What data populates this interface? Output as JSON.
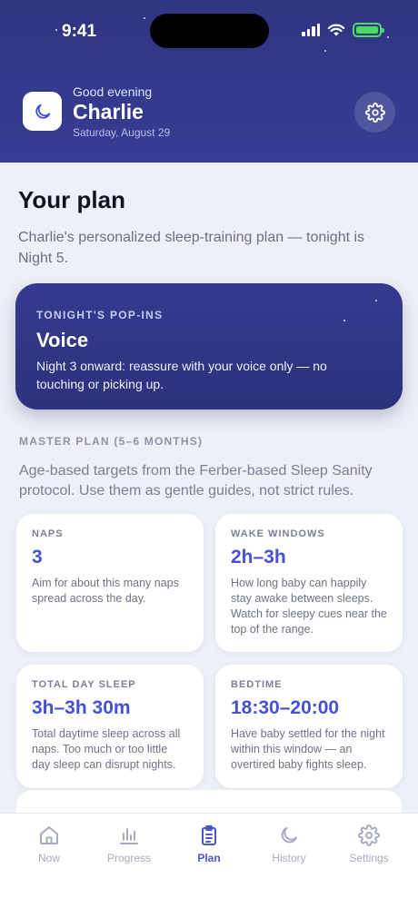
{
  "status_bar": {
    "time": "9:41"
  },
  "header": {
    "greeting": "Good evening",
    "name": "Charlie",
    "date": "Saturday, August 29"
  },
  "plan": {
    "title": "Your plan",
    "description": "Charlie's personalized sleep-training plan — tonight is Night 5."
  },
  "tonight": {
    "kicker": "TONIGHT'S POP-INS",
    "title": "Voice",
    "description": "Night 3 onward: reassure with your voice only — no touching or picking up."
  },
  "master_plan": {
    "label": "MASTER PLAN (5–6 MONTHS)",
    "description": "Age-based targets from the Ferber-based Sleep Sanity protocol. Use them as gentle guides, not strict rules.",
    "cards": [
      {
        "label": "NAPS",
        "value": "3",
        "description": "Aim for about this many naps spread across the day."
      },
      {
        "label": "WAKE WINDOWS",
        "value": "2h–3h",
        "description": "How long baby can happily stay awake between sleeps. Watch for sleepy cues near the top of the range."
      },
      {
        "label": "TOTAL DAY SLEEP",
        "value": "3h–3h 30m",
        "description": "Total daytime sleep across all naps. Too much or too little day sleep can disrupt nights."
      },
      {
        "label": "BEDTIME",
        "value": "18:30–20:00",
        "description": "Have baby settled for the night within this window — an overtired baby fights sleep."
      }
    ]
  },
  "tabs": [
    {
      "label": "Now",
      "icon": "home-icon"
    },
    {
      "label": "Progress",
      "icon": "bar-chart-icon"
    },
    {
      "label": "Plan",
      "icon": "clipboard-icon",
      "active": true
    },
    {
      "label": "History",
      "icon": "moon-icon"
    },
    {
      "label": "Settings",
      "icon": "gear-icon"
    }
  ],
  "colors": {
    "header": "#343b8f",
    "accent": "#4550d6",
    "background": "#eef0f7"
  }
}
